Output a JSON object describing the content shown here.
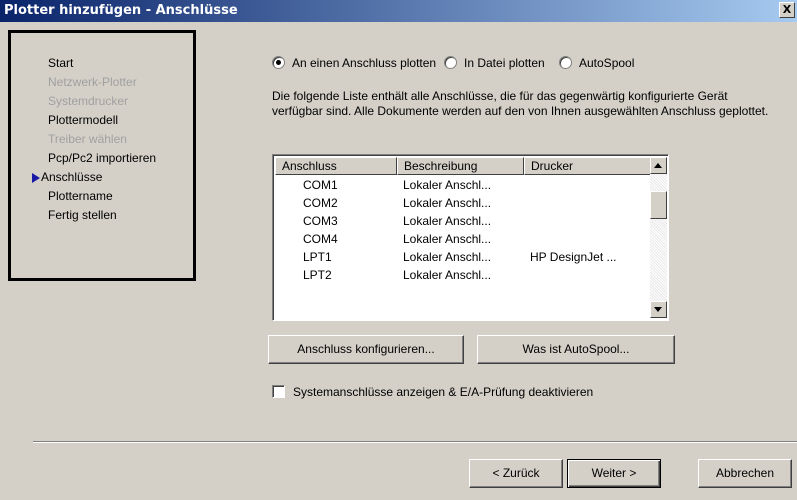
{
  "window": {
    "title": "Plotter hinzufügen - Anschlüsse",
    "close_label": "X"
  },
  "steps": [
    {
      "label": "Start",
      "state": "normal"
    },
    {
      "label": "Netzwerk-Plotter",
      "state": "disabled"
    },
    {
      "label": "Systemdrucker",
      "state": "disabled"
    },
    {
      "label": "Plottermodell",
      "state": "normal"
    },
    {
      "label": "Treiber wählen",
      "state": "disabled"
    },
    {
      "label": "Pcp/Pc2 importieren",
      "state": "normal"
    },
    {
      "label": "Anschlüsse",
      "state": "current"
    },
    {
      "label": "Plottername",
      "state": "normal"
    },
    {
      "label": "Fertig stellen",
      "state": "normal"
    }
  ],
  "plot_options": {
    "port": "An einen Anschluss plotten",
    "file": "In Datei plotten",
    "autospool": "AutoSpool",
    "selected": "port"
  },
  "description": "Die folgende Liste enthält alle Anschlüsse, die für das gegenwärtig konfigurierte Gerät verfügbar sind. Alle Dokumente werden auf den von Ihnen ausgewählten Anschluss geplottet.",
  "port_list": {
    "columns": [
      "Anschluss",
      "Beschreibung",
      "Drucker"
    ],
    "rows": [
      [
        "COM1",
        "Lokaler Anschl...",
        ""
      ],
      [
        "COM2",
        "Lokaler Anschl...",
        ""
      ],
      [
        "COM3",
        "Lokaler Anschl...",
        ""
      ],
      [
        "COM4",
        "Lokaler Anschl...",
        ""
      ],
      [
        "LPT1",
        "Lokaler Anschl...",
        "HP DesignJet ..."
      ],
      [
        "LPT2",
        "Lokaler Anschl...",
        ""
      ]
    ]
  },
  "buttons": {
    "configure": "Anschluss konfigurieren...",
    "what_is_autospool": "Was ist AutoSpool...",
    "back": "< Zurück",
    "next": "Weiter >",
    "cancel": "Abbrechen"
  },
  "show_system_ports": {
    "label": "Systemanschlüsse anzeigen & E/A-Prüfung deaktivieren",
    "checked": false
  }
}
